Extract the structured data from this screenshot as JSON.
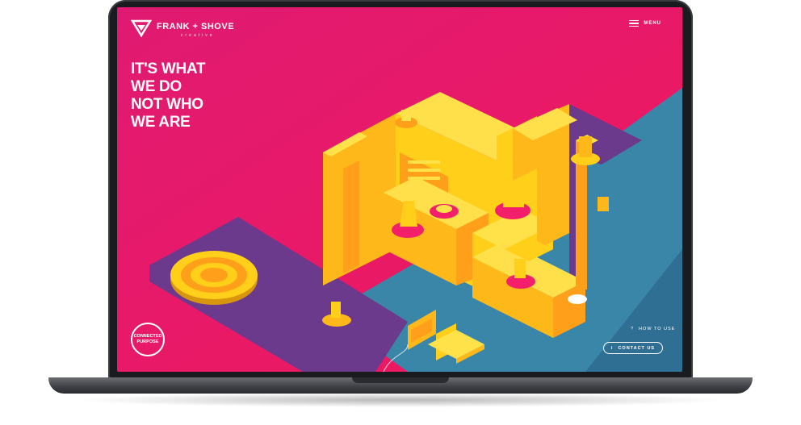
{
  "brand": {
    "name": "FRANK + SHOVE",
    "sub": "creative"
  },
  "menu": {
    "label": "MENU",
    "icon": "hamburger-icon"
  },
  "headline": {
    "lines": [
      "IT'S WHAT",
      "WE DO",
      "NOT WHO",
      "WE ARE"
    ]
  },
  "badge": {
    "line1": "CONNECTED",
    "line2": "PURPOSE"
  },
  "help": {
    "icon_text": "?",
    "label": "HOW TO USE"
  },
  "contact": {
    "icon_text": "i",
    "label": "CONTACT US"
  },
  "colors": {
    "magenta": "#e0126d",
    "pink": "#f31f6b",
    "purple": "#6b3a8c",
    "teal": "#3a86a8",
    "yellow": "#ffcf1a",
    "orange": "#ff9f1a",
    "white": "#ffffff"
  }
}
